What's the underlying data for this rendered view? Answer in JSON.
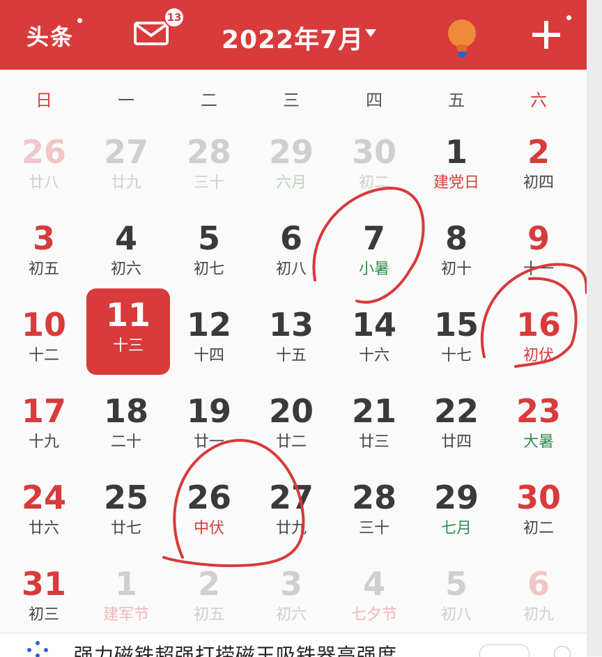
{
  "header": {
    "left_label": "头条",
    "mail_badge": "13",
    "month_title": "2022年7月",
    "icons": [
      "mail-icon",
      "lightbulb-icon",
      "plus-icon",
      "chevron-down-icon"
    ],
    "bg_color": "#d83b3b"
  },
  "weekdays": [
    "日",
    "一",
    "二",
    "三",
    "四",
    "五",
    "六"
  ],
  "days": [
    {
      "num": "26",
      "lunar": "廿八"
    },
    {
      "num": "27",
      "lunar": "廿九"
    },
    {
      "num": "28",
      "lunar": "三十"
    },
    {
      "num": "29",
      "lunar": "六月"
    },
    {
      "num": "30",
      "lunar": "初二"
    },
    {
      "num": "1",
      "lunar": "建党日"
    },
    {
      "num": "2",
      "lunar": "初四"
    },
    {
      "num": "3",
      "lunar": "初五"
    },
    {
      "num": "4",
      "lunar": "初六"
    },
    {
      "num": "5",
      "lunar": "初七"
    },
    {
      "num": "6",
      "lunar": "初八"
    },
    {
      "num": "7",
      "lunar": "小暑"
    },
    {
      "num": "8",
      "lunar": "初十"
    },
    {
      "num": "9",
      "lunar": "十一"
    },
    {
      "num": "10",
      "lunar": "十二"
    },
    {
      "num": "11",
      "lunar": "十三"
    },
    {
      "num": "12",
      "lunar": "十四"
    },
    {
      "num": "13",
      "lunar": "十五"
    },
    {
      "num": "14",
      "lunar": "十六"
    },
    {
      "num": "15",
      "lunar": "十七"
    },
    {
      "num": "16",
      "lunar": "初伏"
    },
    {
      "num": "17",
      "lunar": "十九"
    },
    {
      "num": "18",
      "lunar": "二十"
    },
    {
      "num": "19",
      "lunar": "廿一"
    },
    {
      "num": "20",
      "lunar": "廿二"
    },
    {
      "num": "21",
      "lunar": "廿三"
    },
    {
      "num": "22",
      "lunar": "廿四"
    },
    {
      "num": "23",
      "lunar": "大暑"
    },
    {
      "num": "24",
      "lunar": "廿六"
    },
    {
      "num": "25",
      "lunar": "廿七"
    },
    {
      "num": "26",
      "lunar": "中伏"
    },
    {
      "num": "27",
      "lunar": "廿九"
    },
    {
      "num": "28",
      "lunar": "三十"
    },
    {
      "num": "29",
      "lunar": "七月"
    },
    {
      "num": "30",
      "lunar": "初二"
    },
    {
      "num": "31",
      "lunar": "初三"
    },
    {
      "num": "1",
      "lunar": "建军节"
    },
    {
      "num": "2",
      "lunar": "初五"
    },
    {
      "num": "3",
      "lunar": "初六"
    },
    {
      "num": "4",
      "lunar": "七夕节"
    },
    {
      "num": "5",
      "lunar": "初八"
    },
    {
      "num": "6",
      "lunar": "初九"
    }
  ],
  "bottom": {
    "text": "强力磁铁超强打捞磁王吸铁器高强度"
  }
}
